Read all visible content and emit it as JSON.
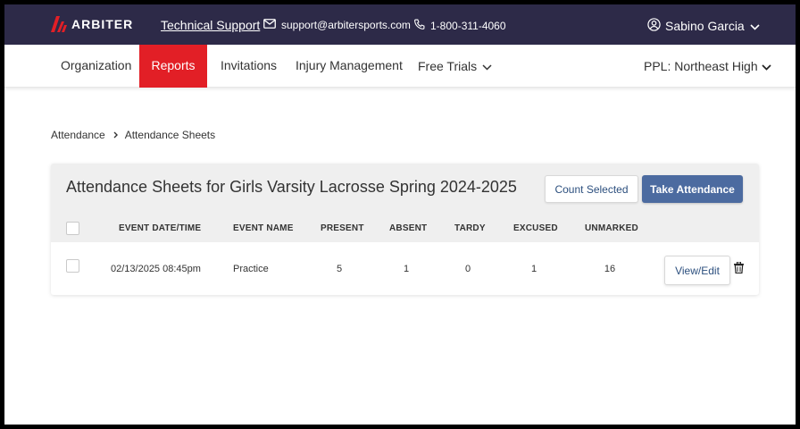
{
  "topbar": {
    "logo_text": "ARBITER",
    "support_link": "Technical Support",
    "email": "support@arbitersports.com",
    "phone": "1-800-311-4060",
    "user_name": "Sabino Garcia"
  },
  "nav": {
    "items": [
      "Organization",
      "Reports",
      "Invitations",
      "Injury Management",
      "Free Trials"
    ],
    "active": "Reports",
    "org_select": "PPL: Northeast High"
  },
  "breadcrumb": [
    "Attendance",
    "Attendance Sheets"
  ],
  "card": {
    "title": "Attendance Sheets for Girls Varsity Lacrosse Spring 2024-2025",
    "count_selected_label": "Count Selected",
    "take_attendance_label": "Take Attendance",
    "columns": [
      "EVENT DATE/TIME",
      "EVENT NAME",
      "PRESENT",
      "ABSENT",
      "TARDY",
      "EXCUSED",
      "UNMARKED"
    ],
    "rows": [
      {
        "date": "02/13/2025 08:45pm",
        "name": "Practice",
        "present": "5",
        "absent": "1",
        "tardy": "0",
        "excused": "1",
        "unmarked": "16",
        "view_label": "View/Edit"
      }
    ]
  },
  "colors": {
    "topbar_bg": "#2d2a48",
    "active_nav": "#e21f26",
    "primary_button": "#4c6ba0",
    "link_text": "#2c4f7e"
  },
  "icons": [
    "arbiter-logo-icon",
    "envelope-icon",
    "phone-icon",
    "user-circle-icon",
    "chevron-down-icon",
    "chevron-right-icon",
    "trash-icon"
  ]
}
